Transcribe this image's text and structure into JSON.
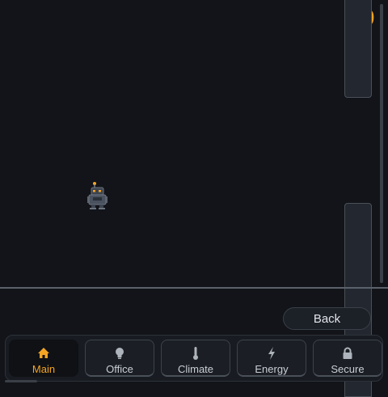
{
  "game": {
    "score": "0",
    "back_label": "Back"
  },
  "tabs": [
    {
      "label": "Main",
      "icon": "home-icon",
      "active": true
    },
    {
      "label": "Office",
      "icon": "lightbulb-icon",
      "active": false
    },
    {
      "label": "Climate",
      "icon": "thermometer-icon",
      "active": false
    },
    {
      "label": "Energy",
      "icon": "lightning-icon",
      "active": false
    },
    {
      "label": "Secure",
      "icon": "lock-icon",
      "active": false
    }
  ],
  "colors": {
    "background": "#121419",
    "accent": "#f5a524",
    "pipe": "#23272f",
    "ground": "#5a616b"
  }
}
